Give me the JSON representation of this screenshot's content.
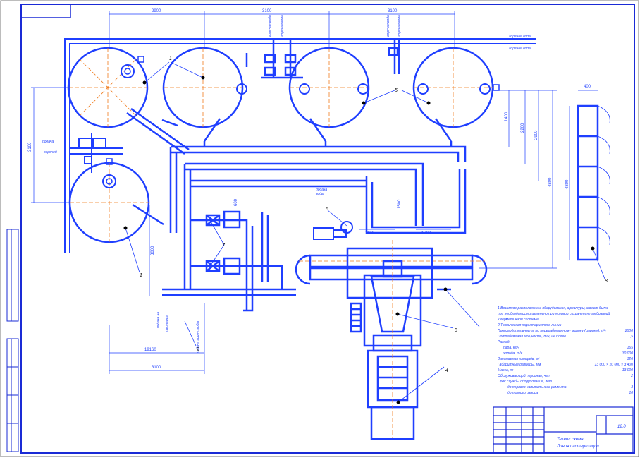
{
  "colors": {
    "primary": "#1f3fff",
    "pipe": "#1f3fff",
    "axis": "#f07c1e",
    "frame": "#1a2bd6"
  },
  "dimensions": {
    "top": [
      "2900",
      "3100",
      "3100"
    ],
    "left": "3100",
    "bottom_inner": "19160",
    "bottom_outer": "3100",
    "mid_1": "3000",
    "right": [
      "1400",
      "2200",
      "2900",
      "4800"
    ],
    "ladder_width": "400",
    "ladder_height": "4800",
    "mid_small": [
      "1100",
      "1700",
      "600",
      "1500"
    ]
  },
  "callouts": [
    "1",
    "1",
    "2",
    "3",
    "4",
    "5",
    "6",
    "7",
    "8"
  ],
  "pipe_labels": {
    "top_right_1": "горячая вода",
    "top_right_2": "горячая вода",
    "left_1": "подача",
    "left_2": "горячей",
    "middle_1": "подача",
    "middle_2": "воды",
    "vertical_1": "горячая вода",
    "vertical_2": "горячая вода",
    "vertical_3": "горячая вода",
    "vertical_4": "горячая вода",
    "bottom_v1": "подача на",
    "bottom_v2": "пастериз.",
    "bottom_v3": "подача горяч. воды"
  },
  "notes": {
    "line1": "1 Взаимное расположение оборудования, арматуры, может быть",
    "line2": "при необходимости изменено при условии сохранения требований",
    "line3": "к герметичной системе",
    "line4": "2 Техническая характеристика линии",
    "line5": "Производительность по переработанному молоку (сырому), л/ч",
    "line5_val": "2500",
    "line6": "Потребляемая мощность, т/ч, не более",
    "line6_val": "1,5",
    "line7": "Расход:",
    "line8": "пара, кг/ч",
    "line8_val": "165",
    "line9": "холода, т/ч",
    "line9_val": "30 000",
    "line10": "Занимаемая площадь, м²",
    "line10_val": "126",
    "line11": "Габаритные размеры, мм",
    "line11_val": "13 000 × 10 000 × 3 400",
    "line12": "Масса, кг",
    "line12_val": "13 000",
    "line13": "Обслуживающий персонал, чел",
    "line13_val": "2",
    "line14": "Срок службы оборудования, лет",
    "line15": "до первого капитального ремонта",
    "line15_val": "3",
    "line16": "до полного износа",
    "line16_val": "10"
  },
  "title_block": {
    "sheet_no": "12.0",
    "doc_code": "Технол.схема",
    "name": "Линия пастеризации"
  }
}
